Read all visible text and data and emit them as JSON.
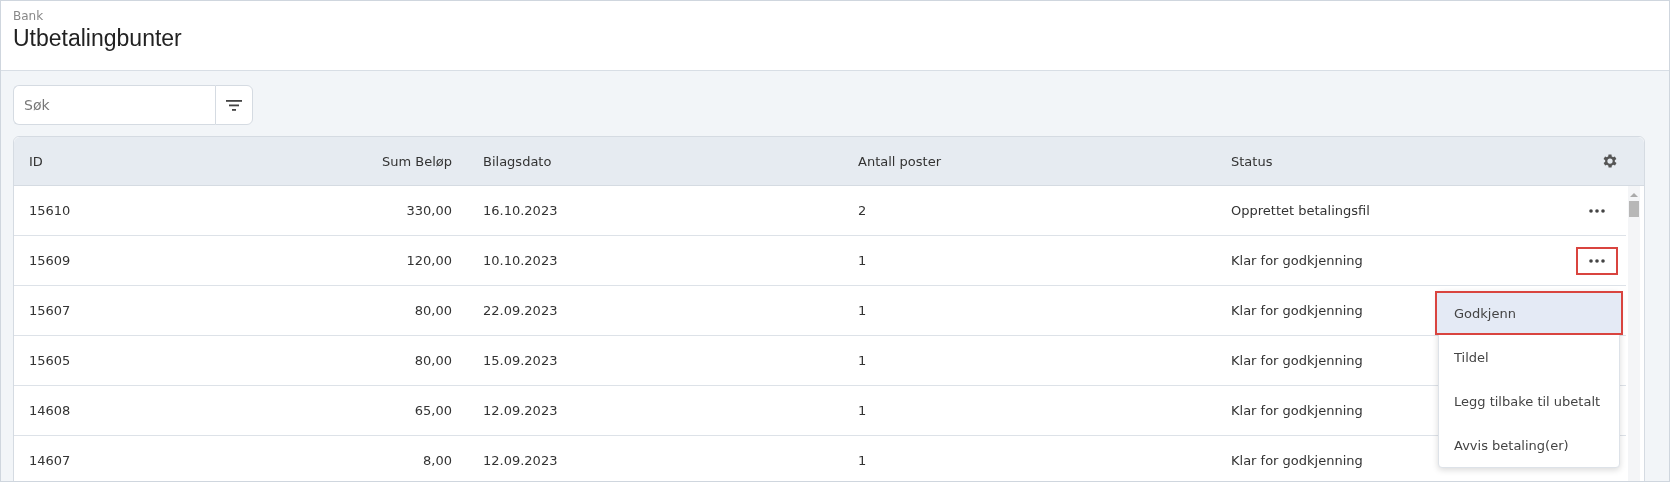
{
  "breadcrumb": "Bank",
  "title": "Utbetalingbunter",
  "search": {
    "placeholder": "Søk"
  },
  "table": {
    "columns": [
      "ID",
      "Sum Beløp",
      "Bilagsdato",
      "Antall poster",
      "Status"
    ],
    "rows": [
      {
        "cells": [
          "15610",
          "330,00",
          "16.10.2023",
          "2",
          "Opprettet betalingsfil"
        ],
        "menu_open": false
      },
      {
        "cells": [
          "15609",
          "120,00",
          "10.10.2023",
          "1",
          "Klar for godkjenning"
        ],
        "menu_open": true
      },
      {
        "cells": [
          "15607",
          "80,00",
          "22.09.2023",
          "1",
          "Klar for godkjenning"
        ],
        "menu_open": false
      },
      {
        "cells": [
          "15605",
          "80,00",
          "15.09.2023",
          "1",
          "Klar for godkjenning"
        ],
        "menu_open": false
      },
      {
        "cells": [
          "14608",
          "65,00",
          "12.09.2023",
          "1",
          "Klar for godkjenning"
        ],
        "menu_open": false
      },
      {
        "cells": [
          "14607",
          "8,00",
          "12.09.2023",
          "1",
          "Klar for godkjenning"
        ],
        "menu_open": false
      }
    ]
  },
  "row_menu": {
    "items": [
      {
        "label": "Godkjenn",
        "selected": true
      },
      {
        "label": "Tildel",
        "selected": false
      },
      {
        "label": "Legg tilbake til ubetalt",
        "selected": false
      },
      {
        "label": "Avvis betaling(er)",
        "selected": false
      }
    ]
  }
}
